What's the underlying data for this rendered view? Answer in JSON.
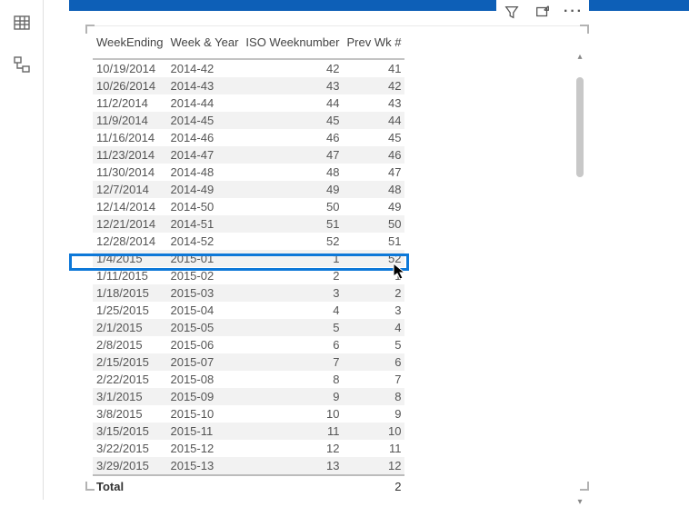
{
  "columns": [
    {
      "key": "week_ending",
      "label": "WeekEnding",
      "align": "left"
    },
    {
      "key": "week_year",
      "label": "Week & Year",
      "align": "left"
    },
    {
      "key": "iso_weeknumber",
      "label": "ISO Weeknumber",
      "align": "right"
    },
    {
      "key": "prev_wk",
      "label": "Prev Wk #",
      "align": "right"
    }
  ],
  "rows": [
    {
      "week_ending": "10/19/2014",
      "week_year": "2014-42",
      "iso_weeknumber": "42",
      "prev_wk": "41"
    },
    {
      "week_ending": "10/26/2014",
      "week_year": "2014-43",
      "iso_weeknumber": "43",
      "prev_wk": "42"
    },
    {
      "week_ending": "11/2/2014",
      "week_year": "2014-44",
      "iso_weeknumber": "44",
      "prev_wk": "43"
    },
    {
      "week_ending": "11/9/2014",
      "week_year": "2014-45",
      "iso_weeknumber": "45",
      "prev_wk": "44"
    },
    {
      "week_ending": "11/16/2014",
      "week_year": "2014-46",
      "iso_weeknumber": "46",
      "prev_wk": "45"
    },
    {
      "week_ending": "11/23/2014",
      "week_year": "2014-47",
      "iso_weeknumber": "47",
      "prev_wk": "46"
    },
    {
      "week_ending": "11/30/2014",
      "week_year": "2014-48",
      "iso_weeknumber": "48",
      "prev_wk": "47"
    },
    {
      "week_ending": "12/7/2014",
      "week_year": "2014-49",
      "iso_weeknumber": "49",
      "prev_wk": "48"
    },
    {
      "week_ending": "12/14/2014",
      "week_year": "2014-50",
      "iso_weeknumber": "50",
      "prev_wk": "49"
    },
    {
      "week_ending": "12/21/2014",
      "week_year": "2014-51",
      "iso_weeknumber": "51",
      "prev_wk": "50"
    },
    {
      "week_ending": "12/28/2014",
      "week_year": "2014-52",
      "iso_weeknumber": "52",
      "prev_wk": "51",
      "highlighted": true
    },
    {
      "week_ending": "1/4/2015",
      "week_year": "2015-01",
      "iso_weeknumber": "1",
      "prev_wk": "52"
    },
    {
      "week_ending": "1/11/2015",
      "week_year": "2015-02",
      "iso_weeknumber": "2",
      "prev_wk": "1"
    },
    {
      "week_ending": "1/18/2015",
      "week_year": "2015-03",
      "iso_weeknumber": "3",
      "prev_wk": "2"
    },
    {
      "week_ending": "1/25/2015",
      "week_year": "2015-04",
      "iso_weeknumber": "4",
      "prev_wk": "3"
    },
    {
      "week_ending": "2/1/2015",
      "week_year": "2015-05",
      "iso_weeknumber": "5",
      "prev_wk": "4"
    },
    {
      "week_ending": "2/8/2015",
      "week_year": "2015-06",
      "iso_weeknumber": "6",
      "prev_wk": "5"
    },
    {
      "week_ending": "2/15/2015",
      "week_year": "2015-07",
      "iso_weeknumber": "7",
      "prev_wk": "6"
    },
    {
      "week_ending": "2/22/2015",
      "week_year": "2015-08",
      "iso_weeknumber": "8",
      "prev_wk": "7"
    },
    {
      "week_ending": "3/1/2015",
      "week_year": "2015-09",
      "iso_weeknumber": "9",
      "prev_wk": "8"
    },
    {
      "week_ending": "3/8/2015",
      "week_year": "2015-10",
      "iso_weeknumber": "10",
      "prev_wk": "9"
    },
    {
      "week_ending": "3/15/2015",
      "week_year": "2015-11",
      "iso_weeknumber": "11",
      "prev_wk": "10"
    },
    {
      "week_ending": "3/22/2015",
      "week_year": "2015-12",
      "iso_weeknumber": "12",
      "prev_wk": "11"
    },
    {
      "week_ending": "3/29/2015",
      "week_year": "2015-13",
      "iso_weeknumber": "13",
      "prev_wk": "12"
    }
  ],
  "total": {
    "label": "Total",
    "prev_wk": "2"
  },
  "scroll": {
    "up": "▴",
    "down": "▾"
  },
  "icons": {
    "ellipsis": "···"
  }
}
